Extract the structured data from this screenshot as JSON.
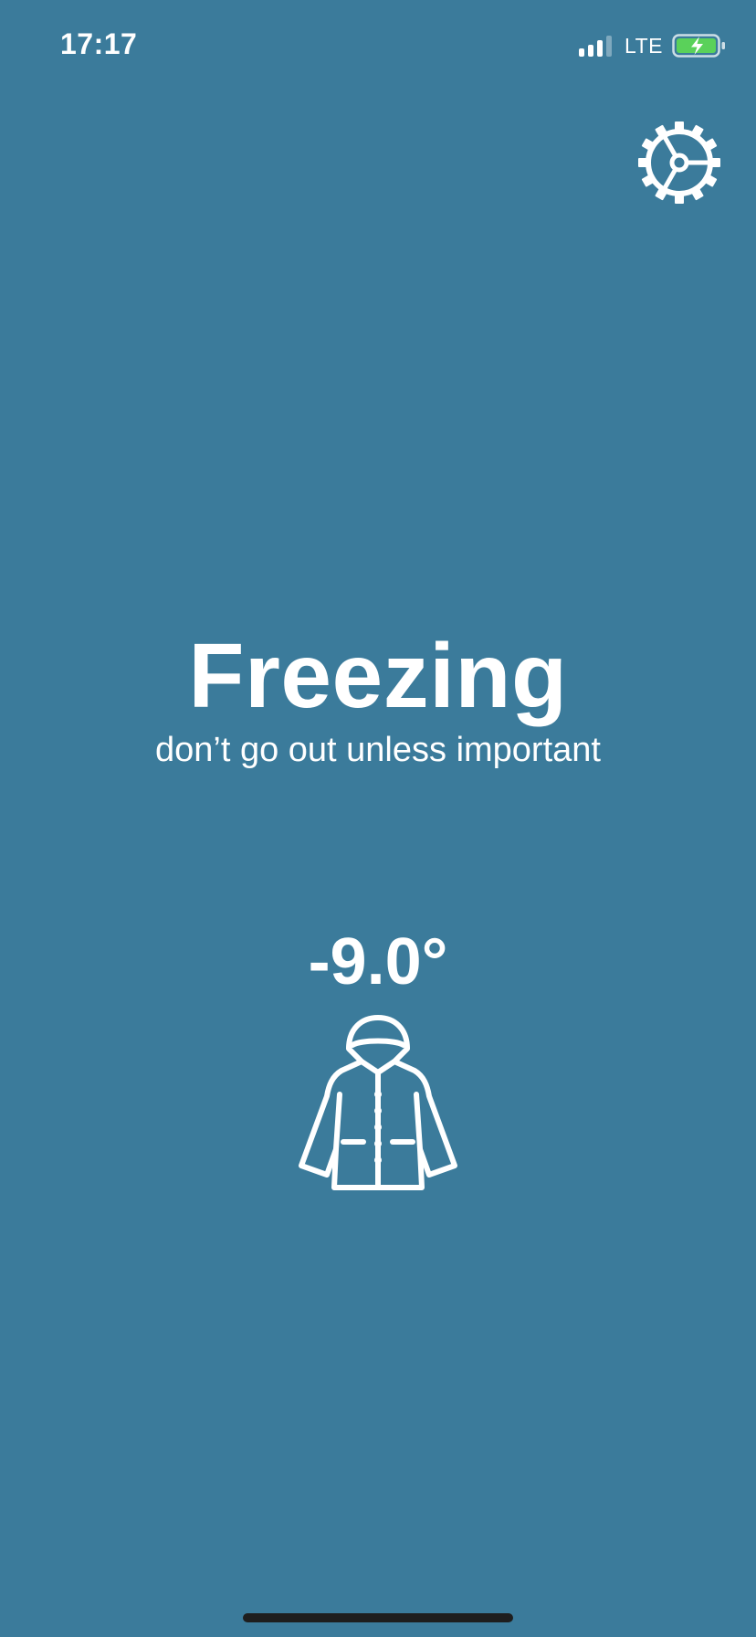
{
  "status_bar": {
    "time": "17:17",
    "network": "LTE",
    "signal_icon": "signal-bars-icon",
    "battery_icon": "battery-charging-icon",
    "battery_color": "#5ad15a"
  },
  "settings": {
    "icon": "gear-icon"
  },
  "weather": {
    "condition": "Freezing",
    "advice": "don’t go out unless important",
    "temperature": "-9.0°",
    "clothing_icon": "raincoat-icon"
  },
  "theme": {
    "background": "#3b7b9b",
    "foreground": "#ffffff"
  }
}
